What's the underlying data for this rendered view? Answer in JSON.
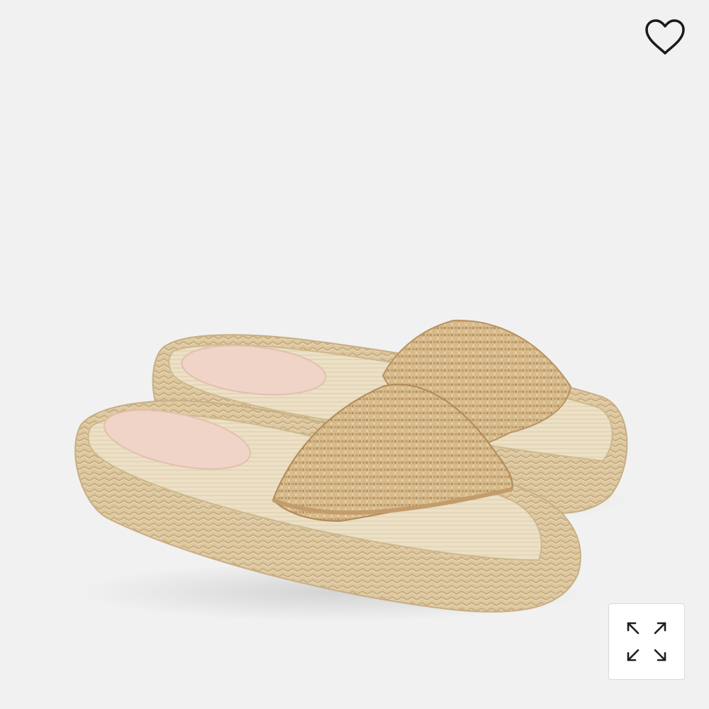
{
  "viewer": {
    "background_color": "#f1f1f1",
    "product_image": {
      "icon": "espadrille-slide-sandals-photo",
      "accent_color": "#d8c096",
      "footbed_color": "#f0d2c6"
    },
    "favorite_button": {
      "icon": "heart-outline-icon"
    },
    "expand_button": {
      "icon": "expand-arrows-icon"
    }
  }
}
